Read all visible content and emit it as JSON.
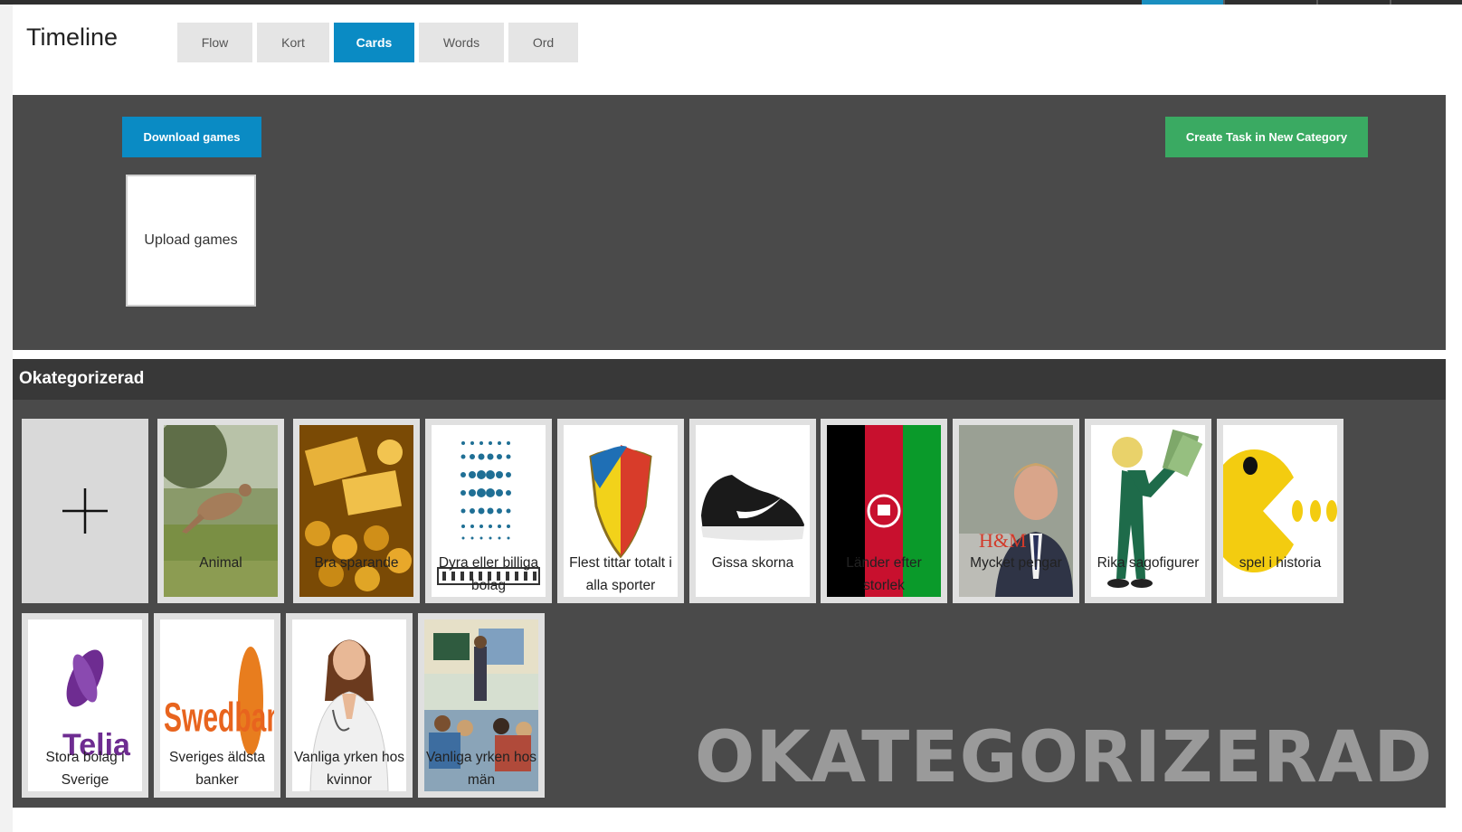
{
  "header": {
    "title": "Timeline",
    "tabs": [
      {
        "label": "Flow"
      },
      {
        "label": "Kort"
      },
      {
        "label": "Cards",
        "active": true
      },
      {
        "label": "Words"
      },
      {
        "label": "Ord"
      }
    ]
  },
  "actions": {
    "download_label": "Download games",
    "upload_label": "Upload games",
    "create_label": "Create Task in New Category"
  },
  "category": {
    "title": "Okategorizerad",
    "watermark": "OKATEGORIZERAD",
    "add_icon": "plus-icon",
    "cards": [
      {
        "label": "Animal",
        "image": "kangaroo"
      },
      {
        "label": "Bra sparande",
        "image": "gold-bars-coins"
      },
      {
        "label": "Dyra eller billiga bolag",
        "image": "fingerprints-logo"
      },
      {
        "label": "Flest tittar totalt i alla sporter",
        "image": "dif-crest"
      },
      {
        "label": "Gissa skorna",
        "image": "nike-shoe"
      },
      {
        "label": "Länder efter storlek",
        "image": "afghanistan-flag"
      },
      {
        "label": "Mycket pengar",
        "image": "businessman-portrait"
      },
      {
        "label": "Rika sagofigurer",
        "image": "cartoon-rich-man"
      },
      {
        "label": "spel i historia",
        "image": "pacman"
      },
      {
        "label": "Stora bolag i Sverige",
        "image": "telia-logo"
      },
      {
        "label": "Sveriges äldsta banker",
        "image": "swedbank-logo"
      },
      {
        "label": "Vanliga yrken hos kvinnor",
        "image": "doctor-woman"
      },
      {
        "label": "Vanliga yrken hos män",
        "image": "classroom-teacher"
      }
    ]
  },
  "colors": {
    "accent_blue": "#0a8bc4",
    "create_green": "#3aaa62",
    "panel_bg": "#4a4a4a",
    "header_bg": "#383838"
  }
}
